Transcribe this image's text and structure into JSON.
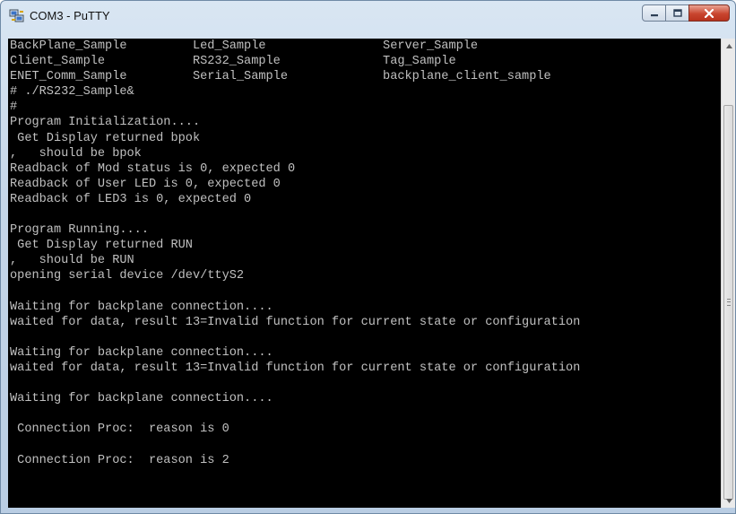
{
  "window": {
    "title": "COM3 - PuTTY"
  },
  "titlebar": {
    "app_icon": "putty-computers-icon",
    "minimize_icon": "minimize-icon",
    "maximize_icon": "maximize-icon",
    "close_icon": "close-icon"
  },
  "terminal": {
    "lines": [
      "BackPlane_Sample         Led_Sample                Server_Sample",
      "Client_Sample            RS232_Sample              Tag_Sample",
      "ENET_Comm_Sample         Serial_Sample             backplane_client_sample",
      "# ./RS232_Sample&",
      "#",
      "Program Initialization....",
      " Get Display returned bpok",
      ",   should be bpok",
      "Readback of Mod status is 0, expected 0",
      "Readback of User LED is 0, expected 0",
      "Readback of LED3 is 0, expected 0",
      "",
      "Program Running....",
      " Get Display returned RUN",
      ",   should be RUN",
      "opening serial device /dev/ttyS2",
      "",
      "Waiting for backplane connection....",
      "waited for data, result 13=Invalid function for current state or configuration",
      "",
      "Waiting for backplane connection....",
      "waited for data, result 13=Invalid function for current state or configuration",
      "",
      "Waiting for backplane connection....",
      "",
      " Connection Proc:  reason is 0",
      "",
      " Connection Proc:  reason is 2"
    ]
  },
  "scrollbar": {
    "up_icon": "scroll-up-arrow-icon",
    "down_icon": "scroll-down-arrow-icon"
  }
}
